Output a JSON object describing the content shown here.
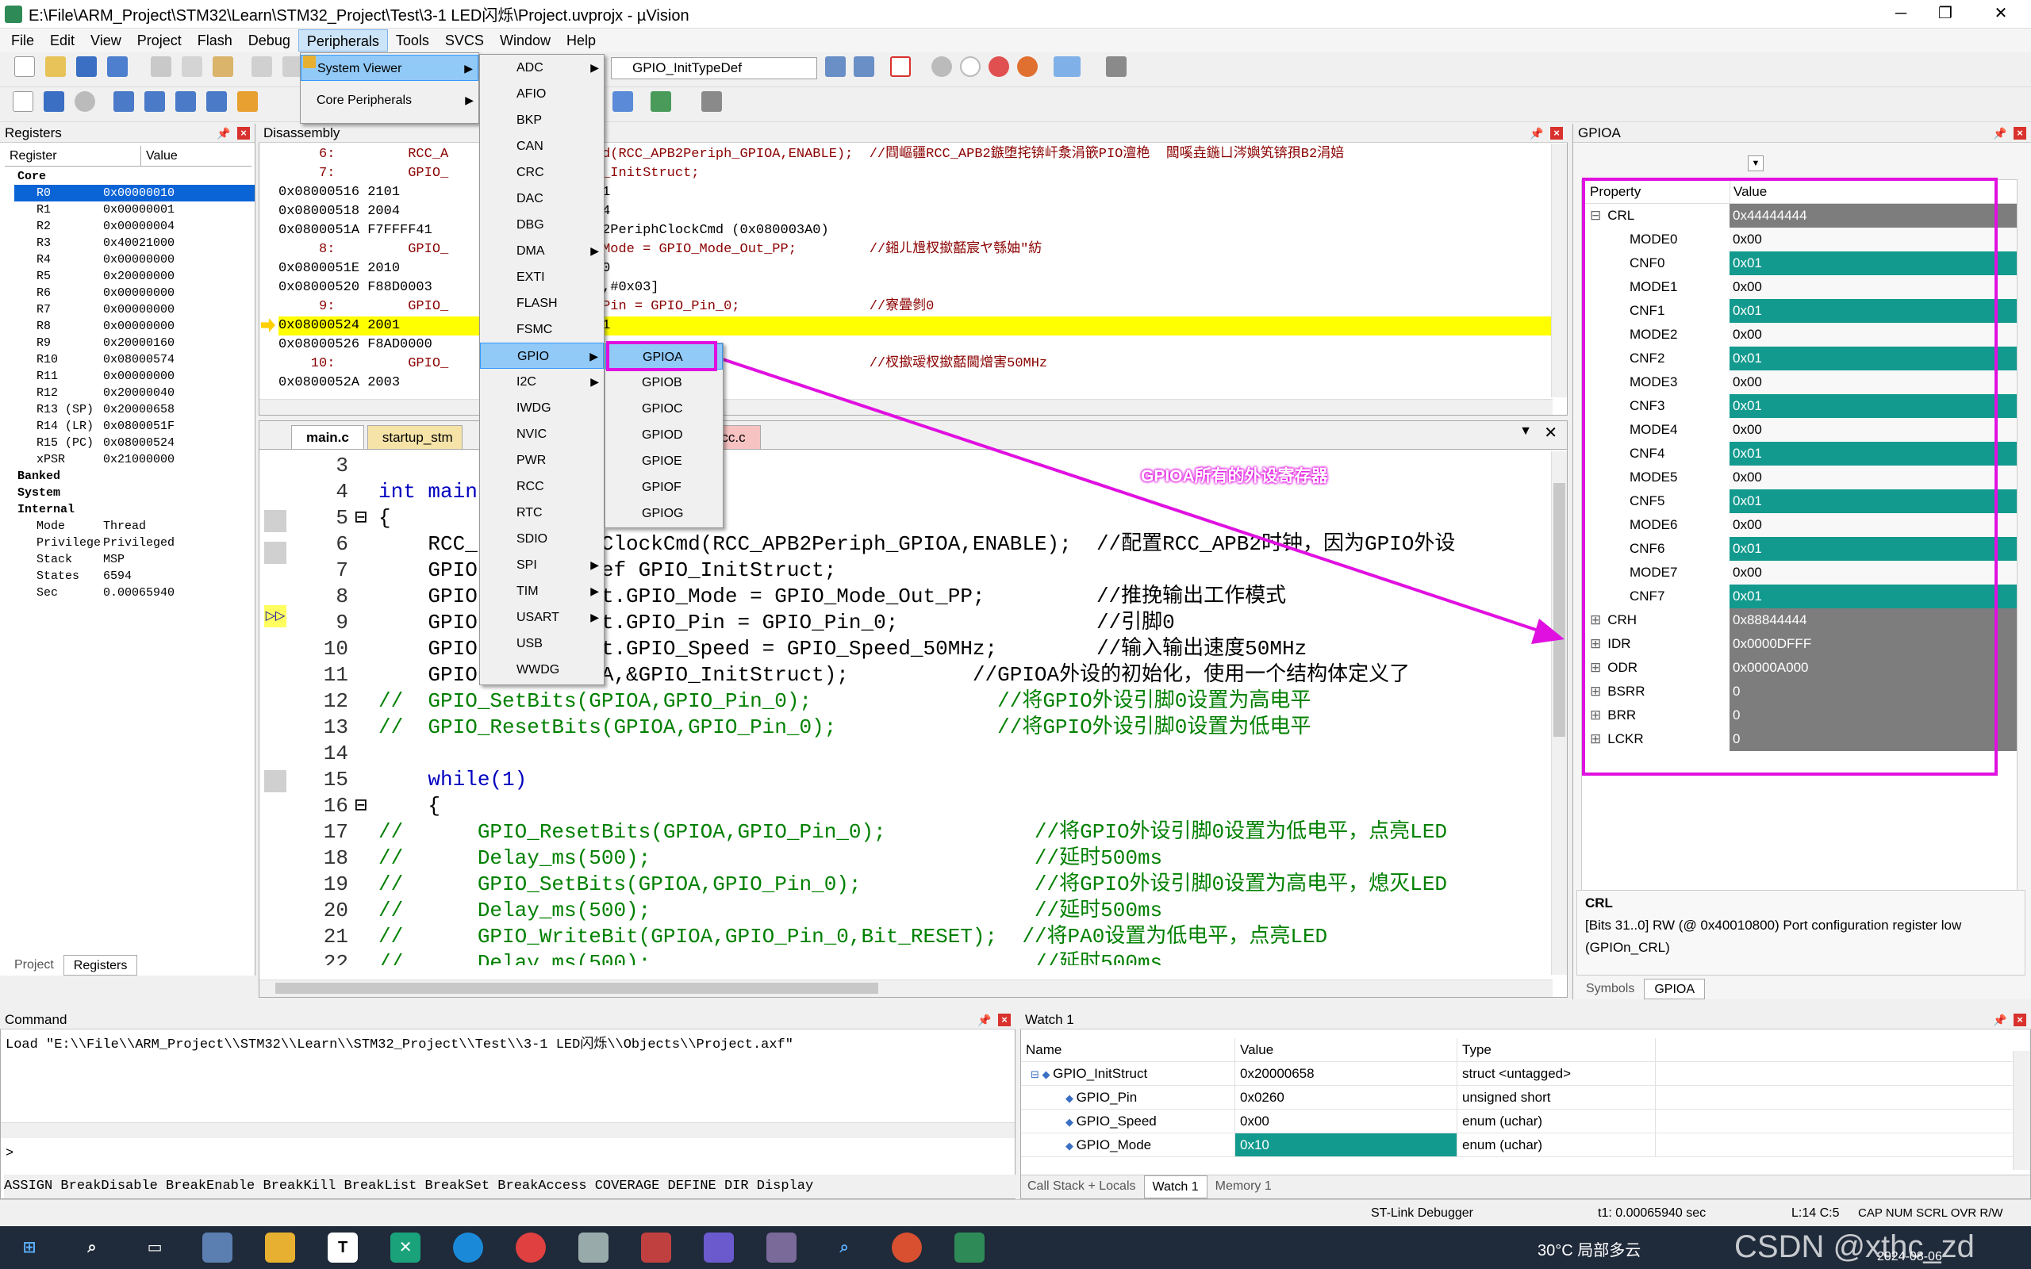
{
  "window": {
    "title": "E:\\File\\ARM_Project\\STM32\\Learn\\STM32_Project\\Test\\3-1 LED闪烁\\Project.uvprojx - µVision",
    "minimize": "─",
    "maximize": "❐",
    "close": "✕"
  },
  "menubar": [
    "File",
    "Edit",
    "View",
    "Project",
    "Flash",
    "Debug",
    "Peripherals",
    "Tools",
    "SVCS",
    "Window",
    "Help"
  ],
  "toolbar": {
    "combo_value": "GPIO_InitTypeDef"
  },
  "peripherals_menu": {
    "items": [
      "System Viewer",
      "Core Peripherals"
    ]
  },
  "system_viewer_menu": {
    "items": [
      "ADC",
      "AFIO",
      "BKP",
      "CAN",
      "CRC",
      "DAC",
      "DBG",
      "DMA",
      "EXTI",
      "FLASH",
      "FSMC",
      "GPIO",
      "I2C",
      "IWDG",
      "NVIC",
      "PWR",
      "RCC",
      "RTC",
      "SDIO",
      "SPI",
      "TIM",
      "USART",
      "USB",
      "WWDG"
    ]
  },
  "gpio_menu": {
    "items": [
      "GPIOA",
      "GPIOB",
      "GPIOC",
      "GPIOD",
      "GPIOE",
      "GPIOF",
      "GPIOG"
    ]
  },
  "registers_panel": {
    "title": "Registers",
    "col_register": "Register",
    "col_value": "Value",
    "rows": [
      {
        "name": "Core",
        "value": ""
      },
      {
        "name": "R0",
        "value": "0x00000010"
      },
      {
        "name": "R1",
        "value": "0x00000001"
      },
      {
        "name": "R2",
        "value": "0x00000004"
      },
      {
        "name": "R3",
        "value": "0x40021000"
      },
      {
        "name": "R4",
        "value": "0x00000000"
      },
      {
        "name": "R5",
        "value": "0x20000000"
      },
      {
        "name": "R6",
        "value": "0x00000000"
      },
      {
        "name": "R7",
        "value": "0x00000000"
      },
      {
        "name": "R8",
        "value": "0x00000000"
      },
      {
        "name": "R9",
        "value": "0x20000160"
      },
      {
        "name": "R10",
        "value": "0x08000574"
      },
      {
        "name": "R11",
        "value": "0x00000000"
      },
      {
        "name": "R12",
        "value": "0x20000040"
      },
      {
        "name": "R13 (SP)",
        "value": "0x20000658"
      },
      {
        "name": "R14 (LR)",
        "value": "0x0800051F"
      },
      {
        "name": "R15 (PC)",
        "value": "0x08000524"
      },
      {
        "name": "xPSR",
        "value": "0x21000000"
      },
      {
        "name": "Banked",
        "value": ""
      },
      {
        "name": "System",
        "value": ""
      },
      {
        "name": "Internal",
        "value": ""
      },
      {
        "name": "Mode",
        "value": "Thread"
      },
      {
        "name": "Privilege",
        "value": "Privileged"
      },
      {
        "name": "Stack",
        "value": "MSP"
      },
      {
        "name": "States",
        "value": "6594"
      },
      {
        "name": "Sec",
        "value": "0.00065940"
      }
    ],
    "tab_project": "Project",
    "tab_registers": "Registers"
  },
  "disassembly": {
    "title": "Disassembly",
    "lines": [
      "     6:         RCC_A                 Cmd(RCC_APB2Periph_GPIOA,ENABLE);  //閰嶇疆RCC_APB2鏃堕挓锛屽洜涓篏PIO澶栬  闆嗘垚鍦ㄩ涔嬩笂锛孭B2涓婄",
      "     7:         GPIO_                 IO_InitStruct;",
      "0x08000516 2101                       x01",
      "0x08000518 2004                       x04",
      "0x0800051A F7FFFF41                   PB2PeriphClockCmd (0x080003A0)",
      "     8:         GPIO_                 O_Mode = GPIO_Mode_Out_PP;         //鎺ㄦ尳杈撳嚭宸ヤ綔妯″紡",
      "0x0800051E 2010                       x10",
      "0x08000520 F88D0003                   [p,#0x03]",
      "     9:         GPIO_                 O_Pin = GPIO_Pin_0;                //寮曡剼0",
      "0x08000524 2001                       x01",
      "0x08000526 F8AD0000",
      "    10:         GPIO_                 IO_Speed_50MHz;                    //杈撳叆杈撳嚭閫熷害50MHz",
      "0x0800052A 2003                       x03"
    ]
  },
  "editor": {
    "tabs": [
      "main.c",
      "startup_stm",
      "stm32f10x_rcc.c"
    ],
    "lines": [
      {
        "n": "3",
        "code": ""
      },
      {
        "n": "4",
        "code": "int main"
      },
      {
        "n": "5",
        "code": "{"
      },
      {
        "n": "6",
        "code": "    RCC_          ClockCmd(RCC_APB2Periph_GPIOA,ENABLE);  //配置RCC_APB2时钟，因为GPIO外设"
      },
      {
        "n": "7",
        "code": "    GPIO          ef GPIO_InitStruct;"
      },
      {
        "n": "8",
        "code": "    GPIO          t.GPIO_Mode = GPIO_Mode_Out_PP;         //推挽输出工作模式"
      },
      {
        "n": "9",
        "code": "    GPIO          t.GPIO_Pin = GPIO_Pin_0;                //引脚0"
      },
      {
        "n": "10",
        "code": "    GPIO          t.GPIO_Speed = GPIO_Speed_50MHz;        //输入输出速度50MHz"
      },
      {
        "n": "11",
        "code": "    GPIO          A,&GPIO_InitStruct);          //GPIOA外设的初始化，使用一个结构体定义了"
      },
      {
        "n": "12",
        "code": "//  GPIO_SetBits(GPIOA,GPIO_Pin_0);               //将GPIO外设引脚0设置为高电平"
      },
      {
        "n": "13",
        "code": "//  GPIO_ResetBits(GPIOA,GPIO_Pin_0);             //将GPIO外设引脚0设置为低电平"
      },
      {
        "n": "14",
        "code": ""
      },
      {
        "n": "15",
        "code": "    while(1)"
      },
      {
        "n": "16",
        "code": "    {"
      },
      {
        "n": "17",
        "code": "//      GPIO_ResetBits(GPIOA,GPIO_Pin_0);            //将GPIO外设引脚0设置为低电平，点亮LED"
      },
      {
        "n": "18",
        "code": "//      Delay_ms(500);                               //延时500ms"
      },
      {
        "n": "19",
        "code": "//      GPIO_SetBits(GPIOA,GPIO_Pin_0);              //将GPIO外设引脚0设置为高电平，熄灭LED"
      },
      {
        "n": "20",
        "code": "//      Delay_ms(500);                               //延时500ms"
      },
      {
        "n": "21",
        "code": "//      GPIO_WriteBit(GPIOA,GPIO_Pin_0,Bit_RESET);  //将PA0设置为低电平，点亮LED"
      },
      {
        "n": "22",
        "code": "//      Delay_ms(500);                               //延时500ms"
      }
    ]
  },
  "annotation": "GPIOA所有的外设寄存器",
  "gpio_panel": {
    "title": "GPIOA",
    "col_property": "Property",
    "col_value": "Value",
    "rows": [
      {
        "name": "CRL",
        "value": "0x44444444",
        "style": "grey"
      },
      {
        "name": "MODE0",
        "value": "0x00",
        "style": "plain"
      },
      {
        "name": "CNF0",
        "value": "0x01",
        "style": "teal"
      },
      {
        "name": "MODE1",
        "value": "0x00",
        "style": "plain"
      },
      {
        "name": "CNF1",
        "value": "0x01",
        "style": "teal"
      },
      {
        "name": "MODE2",
        "value": "0x00",
        "style": "plain"
      },
      {
        "name": "CNF2",
        "value": "0x01",
        "style": "teal"
      },
      {
        "name": "MODE3",
        "value": "0x00",
        "style": "plain"
      },
      {
        "name": "CNF3",
        "value": "0x01",
        "style": "teal"
      },
      {
        "name": "MODE4",
        "value": "0x00",
        "style": "plain"
      },
      {
        "name": "CNF4",
        "value": "0x01",
        "style": "teal"
      },
      {
        "name": "MODE5",
        "value": "0x00",
        "style": "plain"
      },
      {
        "name": "CNF5",
        "value": "0x01",
        "style": "teal"
      },
      {
        "name": "MODE6",
        "value": "0x00",
        "style": "plain"
      },
      {
        "name": "CNF6",
        "value": "0x01",
        "style": "teal"
      },
      {
        "name": "MODE7",
        "value": "0x00",
        "style": "plain"
      },
      {
        "name": "CNF7",
        "value": "0x01",
        "style": "teal"
      },
      {
        "name": "CRH",
        "value": "0x88844444",
        "style": "grey"
      },
      {
        "name": "IDR",
        "value": "0x0000DFFF",
        "style": "grey"
      },
      {
        "name": "ODR",
        "value": "0x0000A000",
        "style": "grey"
      },
      {
        "name": "BSRR",
        "value": "0",
        "style": "grey"
      },
      {
        "name": "BRR",
        "value": "0",
        "style": "grey"
      },
      {
        "name": "LCKR",
        "value": "0",
        "style": "grey"
      }
    ],
    "desc_title": "CRL",
    "desc_text": "[Bits 31..0] RW (@ 0x40010800) Port configuration register low (GPIOn_CRL)",
    "tab_symbols": "Symbols",
    "tab_gpioa": "GPIOA"
  },
  "command_panel": {
    "title": "Command",
    "output": "Load \"E:\\\\File\\\\ARM_Project\\\\STM32\\\\Learn\\\\STM32_Project\\\\Test\\\\3-1 LED闪烁\\\\Objects\\\\Project.axf\"",
    "prompt": ">",
    "hint": "ASSIGN BreakDisable BreakEnable BreakKill BreakList BreakSet BreakAccess COVERAGE DEFINE DIR Display"
  },
  "watch_panel": {
    "title": "Watch 1",
    "col_name": "Name",
    "col_value": "Value",
    "col_type": "Type",
    "rows": [
      {
        "name": "GPIO_InitStruct",
        "value": "0x20000658",
        "type": "struct <untagged>",
        "hl": false
      },
      {
        "name": "GPIO_Pin",
        "value": "0x0260",
        "type": "unsigned short",
        "hl": false
      },
      {
        "name": "GPIO_Speed",
        "value": "0x00",
        "type": "enum (uchar)",
        "hl": false
      },
      {
        "name": "GPIO_Mode",
        "value": "0x10",
        "type": "enum (uchar)",
        "hl": true
      }
    ],
    "tabs": [
      "Call Stack + Locals",
      "Watch 1",
      "Memory 1"
    ]
  },
  "statusbar": {
    "debugger": "ST-Link Debugger",
    "time": "t1: 0.00065940 sec",
    "pos": "L:14 C:5",
    "flags": "CAP  NUM  SCRL  OVR  R/W"
  },
  "taskbar": {
    "weather": "30°C 局部多云",
    "date": "2024-08-06",
    "watermark": "CSDN @xthc_zd"
  }
}
